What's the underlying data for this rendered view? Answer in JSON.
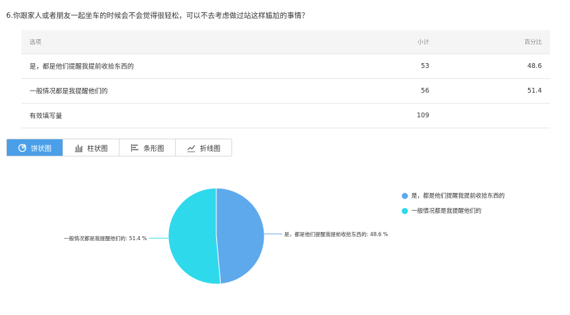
{
  "question": "6.你跟家人或者朋友一起坐车的时候会不会觉得很轻松，可以不去考虑做过站这样尴尬的事情？",
  "table": {
    "headers": [
      "选项",
      "小计",
      "百分比"
    ],
    "rows": [
      {
        "option": "是，都是他们提醒我提前收拾东西的",
        "count": "53",
        "percent": "48.6"
      },
      {
        "option": "一般情况都是我提醒他们的",
        "count": "56",
        "percent": "51.4"
      }
    ],
    "total_label": "有效填写量",
    "total_count": "109"
  },
  "tabs": [
    {
      "label": "饼状图",
      "icon": "pie-chart-icon",
      "active": true
    },
    {
      "label": "柱状图",
      "icon": "bar-chart-icon",
      "active": false
    },
    {
      "label": "条形图",
      "icon": "horizontal-bar-icon",
      "active": false
    },
    {
      "label": "折线图",
      "icon": "line-chart-icon",
      "active": false
    }
  ],
  "colors": {
    "accent": "#4a9fe8",
    "series1": "#5ea9ec",
    "series2": "#2fd9ec"
  },
  "chart_data": {
    "type": "pie",
    "categories": [
      "是，都是他们提醒我提前收拾东西的",
      "一般情况都是我提醒他们的"
    ],
    "values": [
      48.6,
      51.4
    ],
    "slice_labels": [
      "是，都是他们提醒我提前收拾东西的: 48.6 %",
      "一般情况都是我提醒他们的: 51.4 %"
    ],
    "legend": [
      "是，都是他们提醒我提前收拾东西的",
      "一般情况都是我提醒他们的"
    ],
    "legend_position": "top-right"
  }
}
